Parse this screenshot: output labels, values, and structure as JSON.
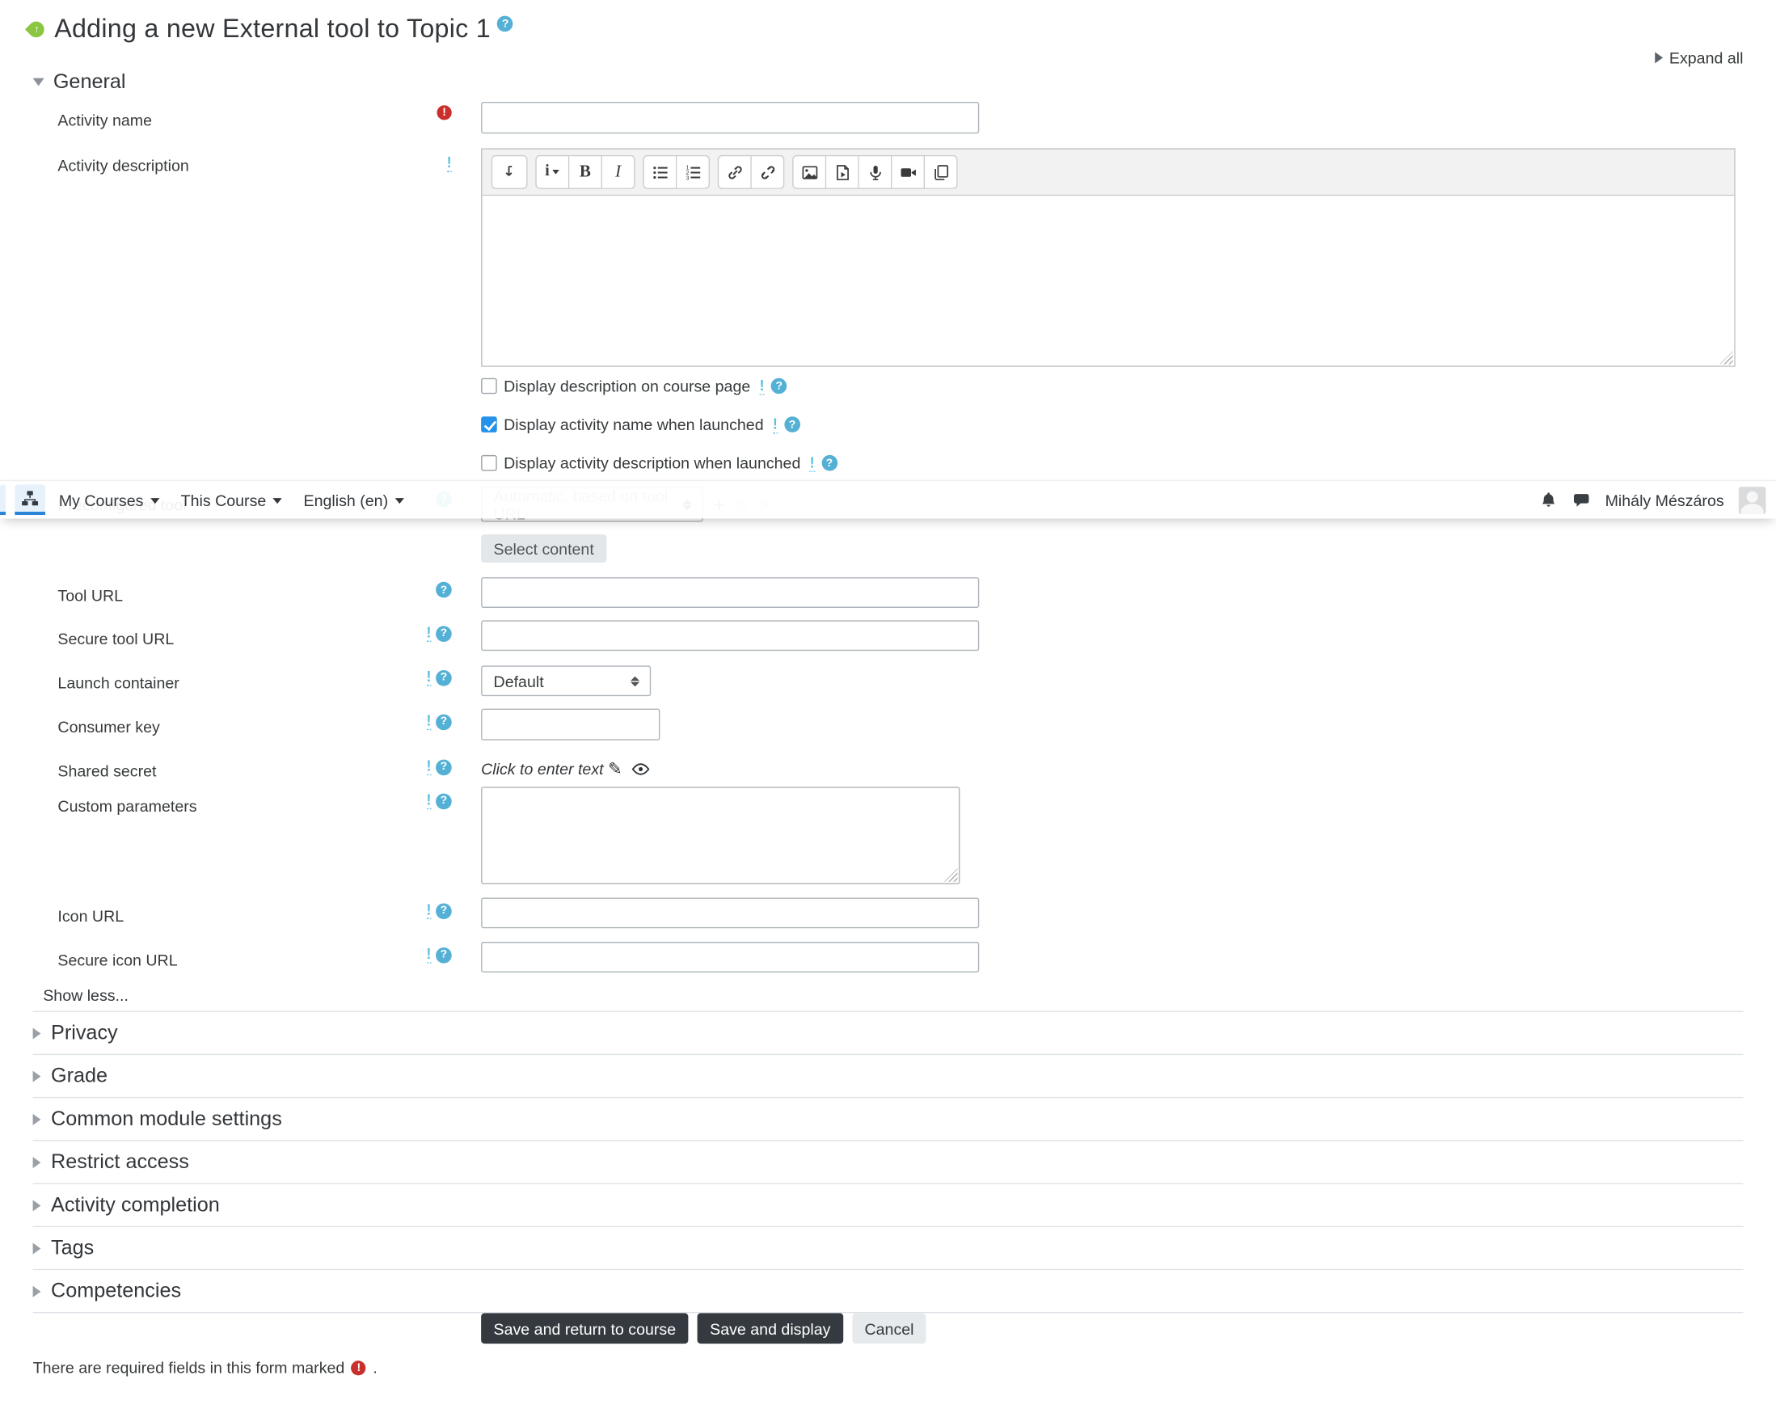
{
  "page": {
    "title": "Adding a new External tool to Topic 1",
    "expand_all": "Expand all",
    "footer_required": "There are required fields in this form marked",
    "footer_period": "."
  },
  "navbar": {
    "items": [
      "My Courses",
      "This Course",
      "English (en)"
    ],
    "user_name": "Mihály Mészáros",
    "icons": [
      "sitemap-icon",
      "bell-icon",
      "chat-icon",
      "avatar"
    ]
  },
  "general": {
    "title": "General"
  },
  "form": {
    "activity_name": {
      "label": "Activity name",
      "value": "",
      "required": true
    },
    "activity_description": {
      "label": "Activity description",
      "value": ""
    },
    "checkboxes": [
      {
        "label": "Display description on course page",
        "checked": false
      },
      {
        "label": "Display activity name when launched",
        "checked": true
      },
      {
        "label": "Display activity description when launched",
        "checked": false
      }
    ],
    "preconfigured_tool": {
      "label": "Preconfigured tool",
      "select_value": "Automatic, based on tool URL",
      "icons": [
        "add-icon",
        "gear-icon",
        "delete-icon"
      ]
    },
    "select_content_label": "Select content",
    "tool_url": {
      "label": "Tool URL",
      "value": ""
    },
    "secure_tool_url": {
      "label": "Secure tool URL",
      "value": ""
    },
    "launch_container": {
      "label": "Launch container",
      "value": "Default"
    },
    "consumer_key": {
      "label": "Consumer key",
      "value": ""
    },
    "shared_secret": {
      "label": "Shared secret",
      "value": "Click to enter text",
      "icons": [
        "pencil-icon",
        "eye-icon"
      ]
    },
    "custom_parameters": {
      "label": "Custom parameters",
      "value": ""
    },
    "icon_url": {
      "label": "Icon URL",
      "value": ""
    },
    "secure_icon_url": {
      "label": "Secure icon URL",
      "value": ""
    },
    "show_less": "Show less..."
  },
  "editor": {
    "toolbar_groups": [
      [
        "toolbar-toggle"
      ],
      [
        "paragraph-format",
        "bold",
        "italic"
      ],
      [
        "unordered-list",
        "ordered-list"
      ],
      [
        "link",
        "unlink"
      ],
      [
        "image",
        "media",
        "record-audio",
        "record-video",
        "manage-files"
      ]
    ]
  },
  "sections": [
    "Privacy",
    "Grade",
    "Common module settings",
    "Restrict access",
    "Activity completion",
    "Tags",
    "Competencies"
  ],
  "buttons": {
    "save_return": "Save and return to course",
    "save_display": "Save and display",
    "cancel": "Cancel"
  },
  "colors": {
    "primary_blue": "#2a84d8",
    "checkbox_blue": "#2492eb",
    "help_blue": "#5bc0de",
    "required_red": "#c9302c",
    "button_dark": "#343a40",
    "tool_icon_green": "#8ac640"
  }
}
